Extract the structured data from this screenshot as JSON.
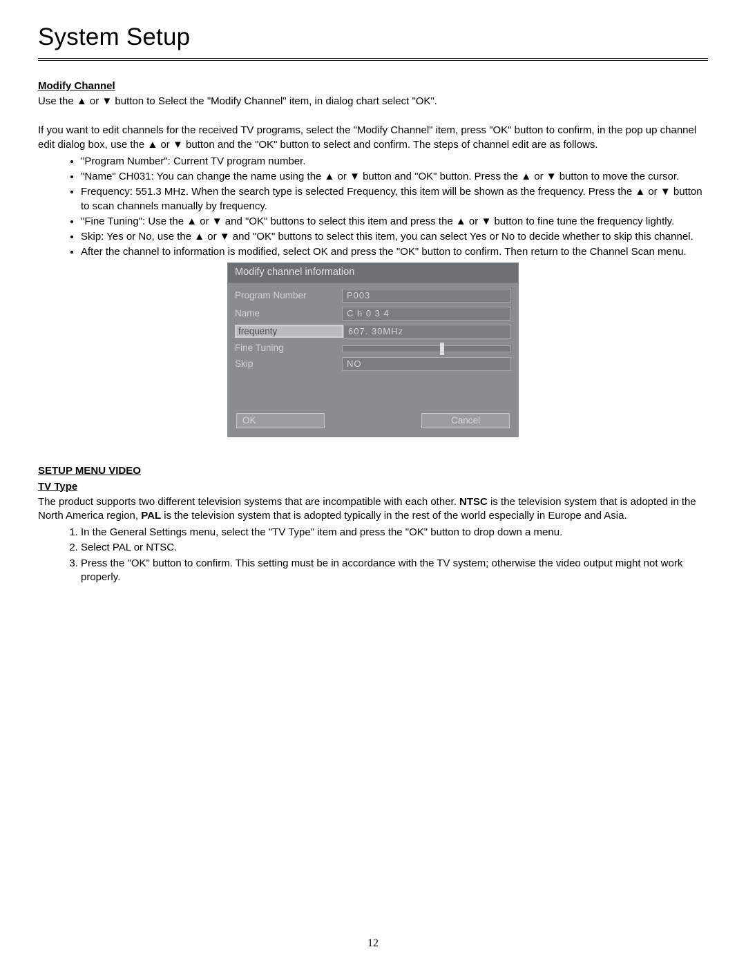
{
  "page_title": "System Setup",
  "page_number": "12",
  "section_modify": {
    "heading": "Modify Channel",
    "intro": "Use the ▲ or ▼ button to Select the \"Modify Channel\" item, in dialog chart select \"OK\".",
    "para2": "If you want to edit channels for the received TV programs, select the \"Modify Channel\" item, press \"OK\" button to confirm, in the pop up channel edit dialog box, use the ▲ or ▼ button and the \"OK\" button to select and confirm. The steps of channel edit are as follows.",
    "bullets": [
      "\"Program Number\": Current TV program number.",
      "\"Name\" CH031: You can change the name using the ▲ or ▼ button and \"OK\" button. Press the ▲ or ▼ button to move the cursor.",
      "Frequency: 551.3 MHz. When the search type is selected Frequency, this item will be shown as the frequency. Press the ▲ or ▼ button to scan channels manually by frequency.",
      "\"Fine Tuning\": Use the ▲ or ▼ and \"OK\" buttons to select this item and press the ▲ or ▼ button to fine tune the frequency lightly.",
      "Skip: Yes or No, use the ▲ or ▼ and \"OK\" buttons to select this item, you can select Yes or No to decide whether to skip this channel.",
      "After the channel to information is modified, select OK and press the \"OK\" button to confirm. Then return to the Channel Scan menu."
    ]
  },
  "osd": {
    "title": "Modify channel information",
    "rows": {
      "program_number_label": "Program Number",
      "program_number_value": "P003",
      "name_label": "Name",
      "name_value": "C h 0 3 4",
      "frequency_label": "frequenty",
      "frequency_value": "607. 30MHz",
      "fine_tuning_label": "Fine Tuning",
      "skip_label": "Skip",
      "skip_value": "NO"
    },
    "ok": "OK",
    "cancel": "Cancel"
  },
  "section_video": {
    "heading": "SETUP MENU VIDEO",
    "sub_heading": "TV Type",
    "para_pre": "The product supports two different television systems that are incompatible with each other. ",
    "ntsc": "NTSC",
    "para_mid": " is the television system that is adopted in the North America region, ",
    "pal": "PAL",
    "para_post": " is the television system that is adopted typically in the rest of the world especially in Europe and Asia.",
    "steps": [
      "In the General Settings menu, select the \"TV Type\" item and press the \"OK\" button to drop down a menu.",
      "Select PAL or NTSC.",
      "Press the \"OK\" button to confirm. This setting must be in accordance with the TV system; otherwise the video output might not work properly."
    ]
  }
}
